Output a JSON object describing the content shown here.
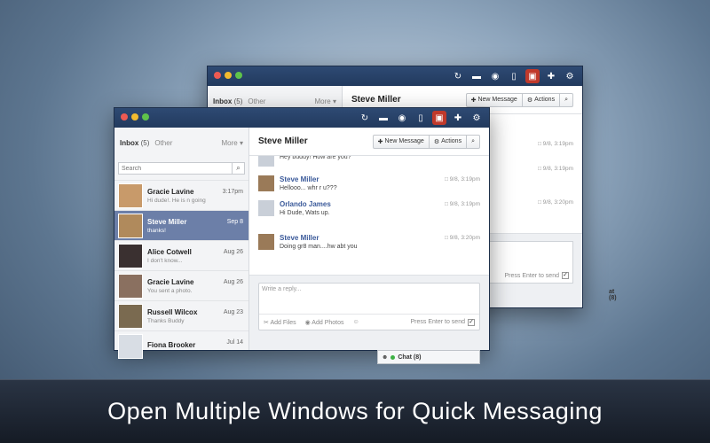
{
  "toolbar_icons": [
    "refresh-icon",
    "chat-bubble-icon",
    "camera-icon",
    "document-icon",
    "lock-icon",
    "plus-icon",
    "settings-icon"
  ],
  "back_window": {
    "tabs": {
      "inbox": "Inbox",
      "inbox_count": "(5)",
      "other": "Other",
      "more": "More"
    },
    "header": {
      "title": "Steve Miller",
      "new_message": "New Message",
      "actions": "Actions"
    },
    "times": [
      "9/8, 3:19pm",
      "9/8, 3:19pm",
      "9/8, 3:20pm"
    ],
    "press_enter": "Press Enter to send",
    "chat": "at (8)"
  },
  "front_window": {
    "tabs": {
      "inbox": "Inbox",
      "inbox_count": "(5)",
      "other": "Other",
      "more": "More"
    },
    "search": {
      "placeholder": "Search"
    },
    "header": {
      "title": "Steve Miller",
      "new_message": "New Message",
      "actions": "Actions"
    },
    "conversations": [
      {
        "name": "Gracie Lavine",
        "preview": "Hi dude!. He is n going",
        "date": "3:17pm",
        "active": false,
        "avatar_color": "#c89a6a"
      },
      {
        "name": "Steve Miller",
        "preview": "thanks!",
        "date": "Sep 8",
        "active": true,
        "avatar_color": "#b08a5c"
      },
      {
        "name": "Alice Cotwell",
        "preview": "I don't know...",
        "date": "Aug 26",
        "active": false,
        "avatar_color": "#3a3030"
      },
      {
        "name": "Gracie Lavine",
        "preview": "You sent a photo.",
        "date": "Aug 26",
        "active": false,
        "avatar_color": "#8a7060"
      },
      {
        "name": "Russell Wilcox",
        "preview": "Thanks Buddy",
        "date": "Aug 23",
        "active": false,
        "avatar_color": "#7a6a50"
      },
      {
        "name": "Fiona Brooker",
        "preview": "",
        "date": "Jul 14",
        "active": false,
        "avatar_color": "#d8dde4"
      }
    ],
    "messages": [
      {
        "sender": "",
        "text": "Hey buddy! How are you?",
        "time": "",
        "avatar_color": "#c9cfd8"
      },
      {
        "sender": "Steve Miller",
        "text": "Hellooo... whr r u???",
        "time": "9/8, 3:19pm",
        "avatar_color": "#9a7a58"
      },
      {
        "sender": "Orlando James",
        "text": "Hi Dude, Wats up.",
        "time": "9/8, 3:19pm",
        "avatar_color": "#c9cfd8"
      },
      {
        "sender": "Steve Miller",
        "text": "Doing gr8 man....hw abt you",
        "time": "9/8, 3:20pm",
        "avatar_color": "#9a7a58"
      }
    ],
    "composer": {
      "placeholder": "Write a reply...",
      "add_files": "Add Files",
      "add_photos": "Add Photos",
      "press_enter": "Press Enter to send"
    },
    "chat": "Chat (8)"
  },
  "banner": {
    "text": "Open Multiple Windows for Quick Messaging"
  }
}
